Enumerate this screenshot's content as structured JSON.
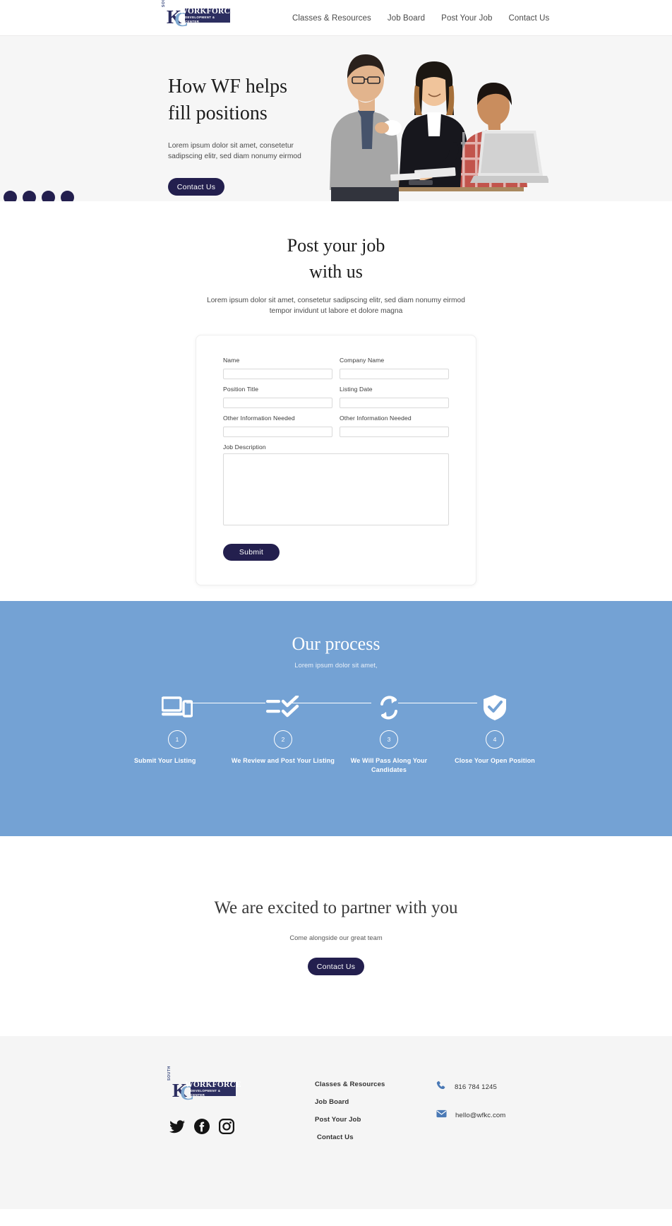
{
  "brand": {
    "logo_south": "SOUTH",
    "logo_k": "K",
    "logo_c": "C",
    "logo_workforce": "WORKFORCE",
    "logo_subtitle": "DEVELOPMENT & CENTER"
  },
  "colors": {
    "navy": "#231f4e",
    "process_blue": "#74a2d4",
    "logo_blue": "#7ea7cf",
    "footer_bg": "#f5f5f5",
    "hero_bg": "#f6f6f6"
  },
  "nav": {
    "items": [
      {
        "label": "Classes & Resources"
      },
      {
        "label": "Job Board"
      },
      {
        "label": "Post Your Job"
      },
      {
        "label": "Contact Us"
      }
    ]
  },
  "hero": {
    "title_line1": "How WF helps",
    "title_line2": "fill positions",
    "subtitle": "Lorem ipsum dolor sit amet, consetetur sadipscing elitr, sed diam nonumy eirmod",
    "cta_label": "Contact Us",
    "image_alt": "three-professionals-at-desk-photo"
  },
  "post_job": {
    "title_line1": "Post your job",
    "title_line2": "with us",
    "subtitle": "Lorem ipsum dolor sit amet, consetetur sadipscing elitr, sed diam nonumy eirmod tempor invidunt ut labore et dolore magna",
    "form": {
      "fields": [
        {
          "label": "Name",
          "value": "",
          "placeholder": ""
        },
        {
          "label": "Company Name",
          "value": "",
          "placeholder": ""
        },
        {
          "label": "Position Title",
          "value": "",
          "placeholder": ""
        },
        {
          "label": "Listing Date",
          "value": "",
          "placeholder": ""
        },
        {
          "label": "Other Information Needed",
          "value": "",
          "placeholder": ""
        },
        {
          "label": "Other Information Needed",
          "value": "",
          "placeholder": ""
        }
      ],
      "description_label": "Job Description",
      "description_value": "",
      "submit_label": "Submit"
    }
  },
  "process": {
    "title": "Our process",
    "subtitle": "Lorem ipsum dolor sit amet,",
    "steps": [
      {
        "number": "1",
        "label": "Submit Your Listing",
        "icon": "laptop-tablet-icon"
      },
      {
        "number": "2",
        "label": "We Review and Post Your Listing",
        "icon": "checklist-icon"
      },
      {
        "number": "3",
        "label": "We Will Pass Along Your Candidates",
        "icon": "sync-arrows-icon"
      },
      {
        "number": "4",
        "label": "Close Your Open Position",
        "icon": "shield-check-icon"
      }
    ]
  },
  "partner": {
    "title": "We are excited to partner with you",
    "subtitle": "Come alongside our great team",
    "cta_label": "Contact Us"
  },
  "footer": {
    "links": [
      {
        "label": "Classes & Resources"
      },
      {
        "label": "Job Board"
      },
      {
        "label": "Post Your Job"
      },
      {
        "label": "Contact Us"
      }
    ],
    "socials": [
      {
        "name": "twitter-icon"
      },
      {
        "name": "facebook-icon"
      },
      {
        "name": "instagram-icon"
      }
    ],
    "phone": "816 784 1245",
    "email": "hello@wfkc.com"
  }
}
